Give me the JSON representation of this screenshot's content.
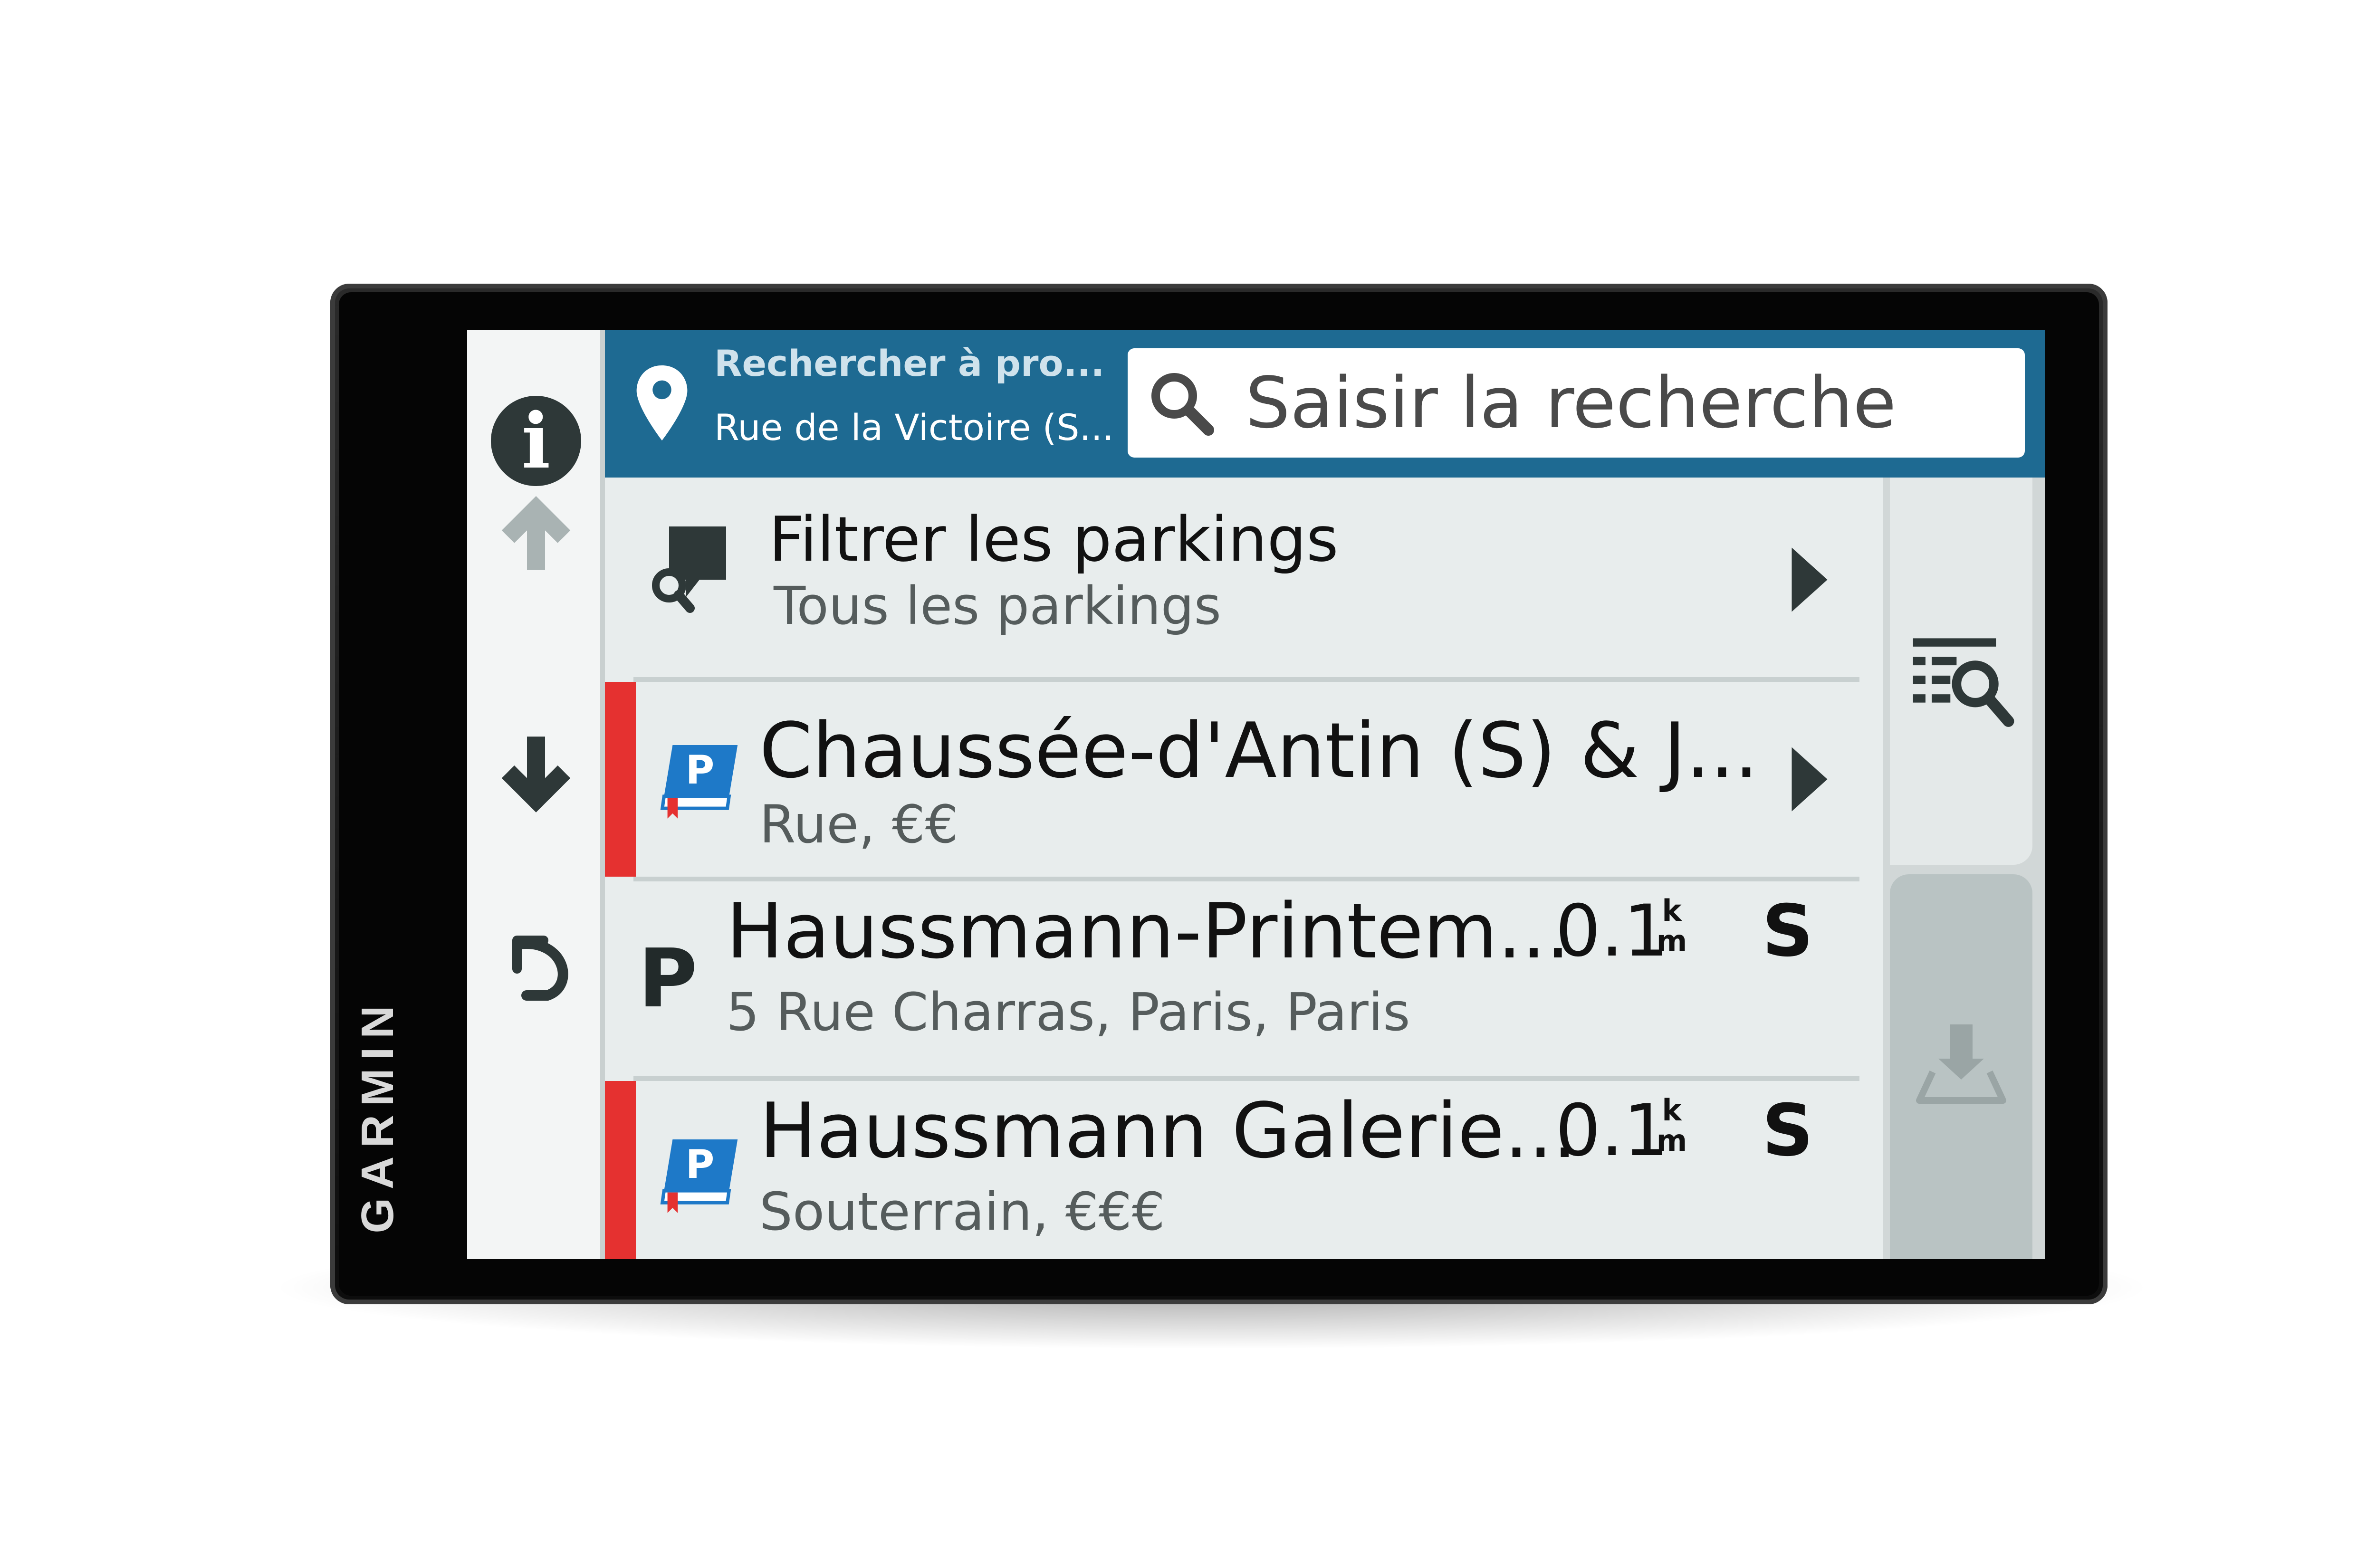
{
  "device": {
    "brand": "GARMIN"
  },
  "sidebar": {
    "info_button": "i",
    "buttons": [
      "info",
      "scroll-up",
      "scroll-down",
      "back"
    ]
  },
  "header": {
    "location_title": "Rechercher à pro...",
    "location_subtitle": "Rue de la Victoire (S...",
    "search_placeholder": "Saisir la recherche",
    "search_value": ""
  },
  "filter": {
    "title": "Filtrer les parkings",
    "subtitle": "Tous les parkings"
  },
  "results": [
    {
      "name": "Chaussée-d'Antin (S) & J...",
      "detail": "Rue, €€",
      "distance": "",
      "unit_top": "",
      "unit_bottom": "",
      "direction": "",
      "icon": "parking-book-icon",
      "flag_color": "#e53130"
    },
    {
      "name": "Haussmann-Printem...",
      "detail": "5 Rue Charras, Paris, Paris",
      "distance": "0.1",
      "unit_top": "k",
      "unit_bottom": "m",
      "direction": "S",
      "icon": "parking-p-icon",
      "flag_color": ""
    },
    {
      "name": "Haussmann Galerie...",
      "detail": "Souterrain, €€€",
      "distance": "0.1",
      "unit_top": "k",
      "unit_bottom": "m",
      "direction": "S",
      "icon": "parking-book-icon",
      "flag_color": "#e53130"
    }
  ],
  "results_p_letter": "P",
  "right_panel": {
    "tabs": [
      "filter-list",
      "map-view"
    ]
  },
  "colors": {
    "header_bg": "#1e6a92",
    "list_bg": "#e8eded",
    "accent_red": "#e53130",
    "parking_blue": "#1e79c8"
  }
}
